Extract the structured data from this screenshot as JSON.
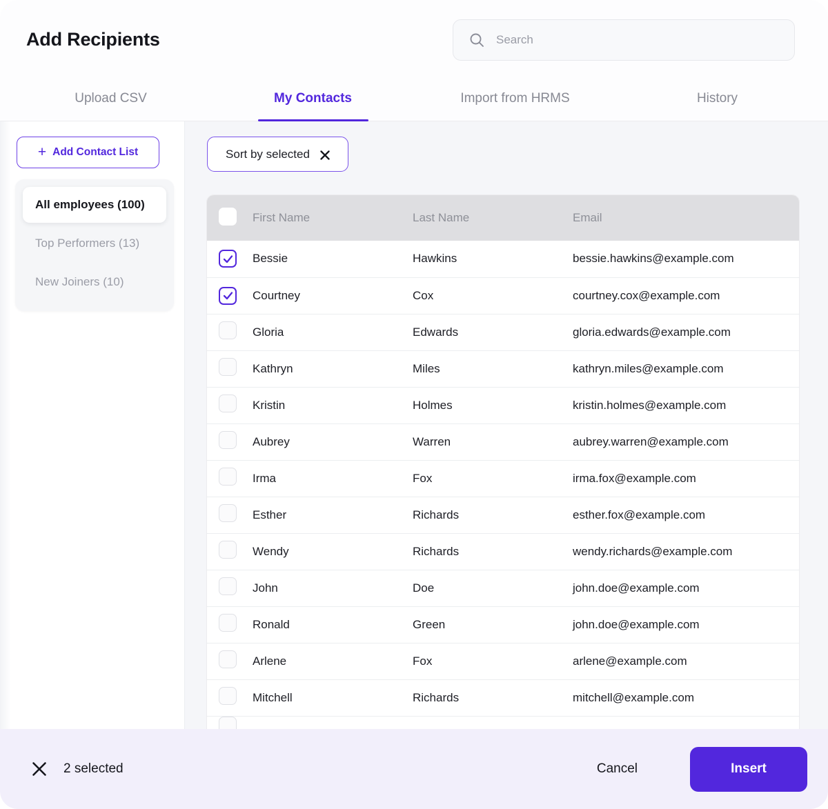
{
  "header": {
    "title": "Add Recipients",
    "search": {
      "placeholder": "Search",
      "value": "",
      "icon": "search-icon"
    }
  },
  "tabs": [
    {
      "label": "Upload CSV",
      "active": false
    },
    {
      "label": "My Contacts",
      "active": true
    },
    {
      "label": "Import from HRMS",
      "active": false
    },
    {
      "label": "History",
      "active": false
    }
  ],
  "sidebar": {
    "add_button_label": "Add Contact List",
    "add_button_icon": "plus-icon",
    "lists": [
      {
        "label": "All employees (100)",
        "selected": true
      },
      {
        "label": "Top Performers (13)",
        "selected": false
      },
      {
        "label": "New Joiners (10)",
        "selected": false
      }
    ]
  },
  "toolbar": {
    "sort_chip_label": "Sort by selected",
    "sort_chip_icon": "close-icon"
  },
  "table": {
    "columns": [
      "First Name",
      "Last Name",
      "Email"
    ],
    "header_checkbox_checked": false,
    "rows": [
      {
        "checked": true,
        "first": "Bessie",
        "last": "Hawkins",
        "email": "bessie.hawkins@example.com"
      },
      {
        "checked": true,
        "first": "Courtney",
        "last": "Cox",
        "email": "courtney.cox@example.com"
      },
      {
        "checked": false,
        "first": "Gloria",
        "last": "Edwards",
        "email": "gloria.edwards@example.com"
      },
      {
        "checked": false,
        "first": "Kathryn",
        "last": "Miles",
        "email": "kathryn.miles@example.com"
      },
      {
        "checked": false,
        "first": "Kristin",
        "last": "Holmes",
        "email": "kristin.holmes@example.com"
      },
      {
        "checked": false,
        "first": "Aubrey",
        "last": "Warren",
        "email": "aubrey.warren@example.com"
      },
      {
        "checked": false,
        "first": "Irma",
        "last": "Fox",
        "email": "irma.fox@example.com"
      },
      {
        "checked": false,
        "first": "Esther",
        "last": "Richards",
        "email": "esther.fox@example.com"
      },
      {
        "checked": false,
        "first": "Wendy",
        "last": "Richards",
        "email": "wendy.richards@example.com"
      },
      {
        "checked": false,
        "first": "John",
        "last": "Doe",
        "email": "john.doe@example.com"
      },
      {
        "checked": false,
        "first": "Ronald",
        "last": "Green",
        "email": "john.doe@example.com"
      },
      {
        "checked": false,
        "first": "Arlene",
        "last": "Fox",
        "email": "arlene@example.com"
      },
      {
        "checked": false,
        "first": "Mitchell",
        "last": "Richards",
        "email": "mitchell@example.com"
      }
    ]
  },
  "footer": {
    "close_icon": "close-icon",
    "selected_text": "2 selected",
    "cancel_label": "Cancel",
    "insert_label": "Insert"
  },
  "colors": {
    "accent": "#5227dd",
    "accent_soft": "#7a52ea",
    "footer_bg": "#f2effb",
    "content_bg": "#f5f6f9",
    "table_header_bg": "#dedee1"
  }
}
